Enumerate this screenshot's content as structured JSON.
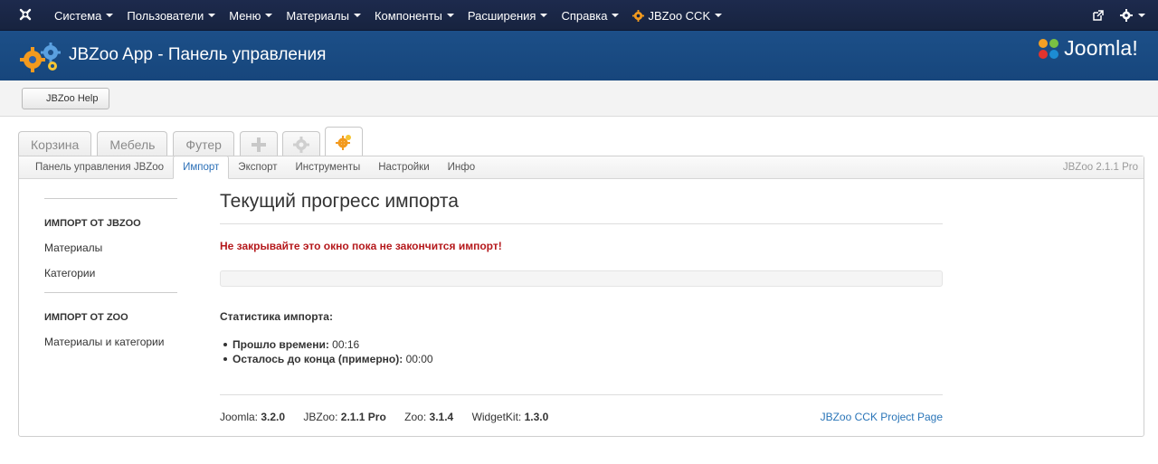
{
  "topbar": {
    "menu": [
      {
        "label": "Система"
      },
      {
        "label": "Пользователи"
      },
      {
        "label": "Меню"
      },
      {
        "label": "Материалы"
      },
      {
        "label": "Компоненты"
      },
      {
        "label": "Расширения"
      },
      {
        "label": "Справка"
      },
      {
        "label": "JBZoo CCK"
      }
    ]
  },
  "header": {
    "title": "JBZoo App - Панель управления",
    "brand": "Joomla!"
  },
  "toolbar": {
    "help_label": "JBZoo Help"
  },
  "app_tabs": [
    {
      "label": "Корзина"
    },
    {
      "label": "Мебель"
    },
    {
      "label": "Футер"
    }
  ],
  "subnav": {
    "tabs": [
      {
        "label": "Панель управления JBZoo"
      },
      {
        "label": "Импорт"
      },
      {
        "label": "Экспорт"
      },
      {
        "label": "Инструменты"
      },
      {
        "label": "Настройки"
      },
      {
        "label": "Инфо"
      }
    ],
    "version": "JBZoo 2.1.1 Pro"
  },
  "sidebar": {
    "sections": [
      {
        "title": "ИМПОРТ ОТ JBZOO",
        "links": [
          "Материалы",
          "Категории"
        ]
      },
      {
        "title": "ИМПОРТ ОТ ZOO",
        "links": [
          "Материалы и категории"
        ]
      }
    ]
  },
  "main": {
    "title": "Текущий прогресс импорта",
    "warning": "Не закрывайте это окно пока не закончится импорт!",
    "progress": 0,
    "stats_title": "Статистика импорта:",
    "stats": [
      {
        "label": "Прошло времени:",
        "value": "00:16"
      },
      {
        "label": "Осталось до конца (примерно):",
        "value": "00:00"
      }
    ]
  },
  "footer": {
    "versions": [
      {
        "name": "Joomla:",
        "value": "3.2.0"
      },
      {
        "name": "JBZoo:",
        "value": "2.1.1 Pro"
      },
      {
        "name": "Zoo:",
        "value": "3.1.4"
      },
      {
        "name": "WidgetKit:",
        "value": "1.3.0"
      }
    ],
    "project_link": "JBZoo CCK Project Page"
  },
  "colors": {
    "topbar": "#1d2a4d",
    "header": "#1c4f88",
    "warning": "#b5191c",
    "link": "#2a75b8",
    "joomla_logo": [
      "#f4a024",
      "#7ac143",
      "#1c8cd3",
      "#e3332d"
    ]
  }
}
